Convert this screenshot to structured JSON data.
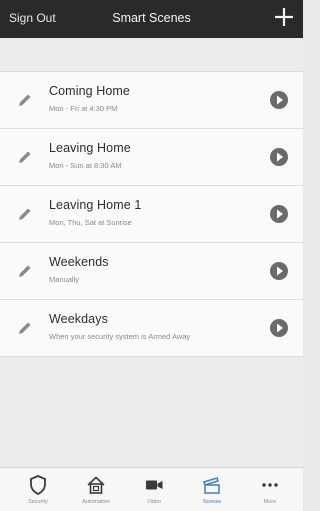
{
  "header": {
    "sign_out": "Sign Out",
    "title": "Smart Scenes",
    "add_icon": "plus-icon"
  },
  "scenes": [
    {
      "name": "Coming Home",
      "schedule": "Mon - Fri at 4:30 PM"
    },
    {
      "name": "Leaving Home",
      "schedule": "Mon - Sun at 8:30 AM"
    },
    {
      "name": "Leaving Home 1",
      "schedule": "Mon, Thu, Sat at Sunrise"
    },
    {
      "name": "Weekends",
      "schedule": "Manually"
    },
    {
      "name": "Weekdays",
      "schedule": "When your security system is Armed Away"
    }
  ],
  "tabs": [
    {
      "label": "Security",
      "icon": "shield-icon"
    },
    {
      "label": "Automation",
      "icon": "house-icon"
    },
    {
      "label": "Video",
      "icon": "video-camera-icon"
    },
    {
      "label": "Scenes",
      "icon": "clapperboard-icon",
      "active": true
    },
    {
      "label": "More",
      "icon": "more-dots-icon"
    }
  ],
  "colors": {
    "header_bg": "#2a2a2a",
    "active_tab": "#3c7fc4",
    "play_button": "#6a6a6a"
  }
}
